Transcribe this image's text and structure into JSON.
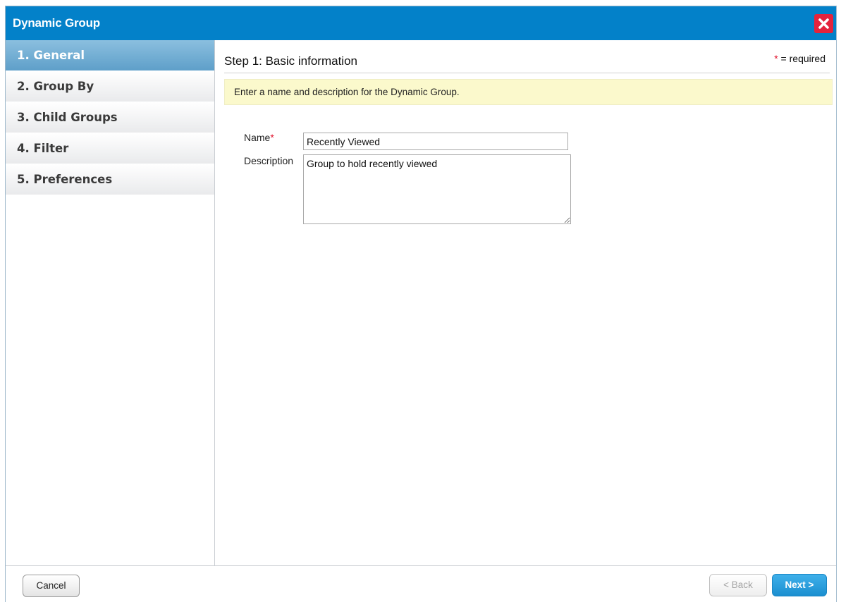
{
  "dialog": {
    "title": "Dynamic Group",
    "close_icon": "close-icon",
    "accent_color": "#0381c9",
    "close_color": "#e4233c"
  },
  "sidebar": {
    "items": [
      {
        "label": "1. General",
        "active": true
      },
      {
        "label": "2. Group By",
        "active": false
      },
      {
        "label": "3. Child Groups",
        "active": false
      },
      {
        "label": "4. Filter",
        "active": false
      },
      {
        "label": "5. Preferences",
        "active": false
      }
    ]
  },
  "main": {
    "step_title": "Step 1: Basic information",
    "required_star": "*",
    "required_text": " = required",
    "info": "Enter a name and description for the Dynamic Group.",
    "form": {
      "name_label": "Name",
      "name_required_star": "*",
      "name_value": "Recently Viewed",
      "description_label": "Description",
      "description_value": "Group to hold recently viewed"
    }
  },
  "footer": {
    "cancel_label": "Cancel",
    "back_label": "< Back",
    "next_label": "Next >"
  }
}
